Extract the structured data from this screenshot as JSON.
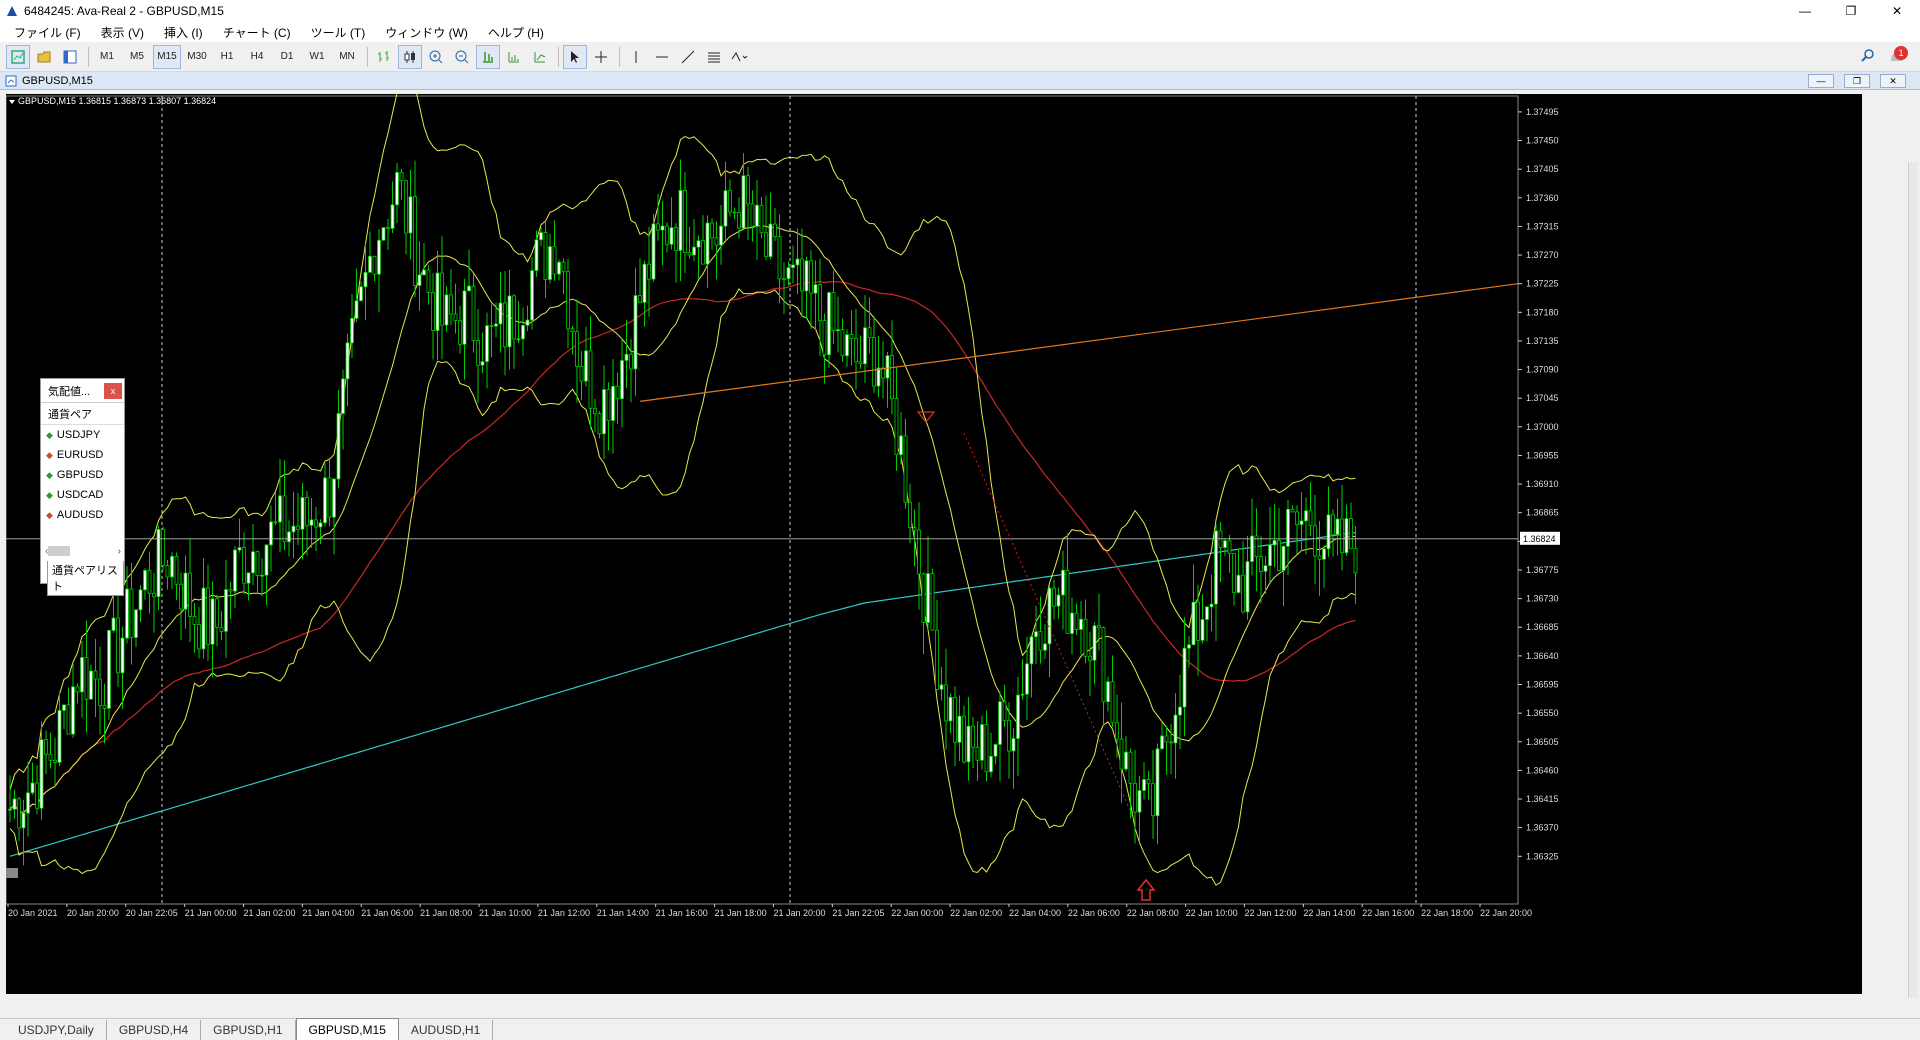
{
  "window": {
    "title": "6484245: Ava-Real 2 - GBPUSD,M15",
    "minimize": "—",
    "restore": "❐",
    "close": "✕"
  },
  "menu": [
    "ファイル (F)",
    "表示 (V)",
    "挿入 (I)",
    "チャート (C)",
    "ツール (T)",
    "ウィンドウ (W)",
    "ヘルプ (H)"
  ],
  "toolbar": {
    "timeframes": [
      "M1",
      "M5",
      "M15",
      "M30",
      "H1",
      "H4",
      "D1",
      "W1",
      "MN"
    ],
    "active_timeframe": "M15",
    "notification_count": "1"
  },
  "chart_window": {
    "title": "GBPUSD,M15",
    "info": "GBPUSD,M15  1.36815 1.36873 1.36807 1.36824"
  },
  "market_watch": {
    "title": "気配値...",
    "close": "x",
    "column": "通貨ペア",
    "symbols": [
      {
        "name": "USDJPY",
        "dir": "up"
      },
      {
        "name": "EURUSD",
        "dir": "down"
      },
      {
        "name": "GBPUSD",
        "dir": "up"
      },
      {
        "name": "USDCAD",
        "dir": "up"
      },
      {
        "name": "AUDUSD",
        "dir": "down"
      }
    ],
    "tab": "通貨ペアリスト"
  },
  "chart_tabs": [
    "USDJPY,Daily",
    "GBPUSD,H4",
    "GBPUSD,H1",
    "GBPUSD,M15",
    "AUDUSD,H1"
  ],
  "active_chart_tab": "GBPUSD,M15",
  "chart_data": {
    "type": "candlestick",
    "symbol": "GBPUSD",
    "timeframe": "M15",
    "ylim": [
      1.3625,
      1.3752
    ],
    "price_ticks": [
      "1.37495",
      "1.37450",
      "1.37405",
      "1.37360",
      "1.37315",
      "1.37270",
      "1.37225",
      "1.37180",
      "1.37135",
      "1.37090",
      "1.37045",
      "1.37000",
      "1.36955",
      "1.36910",
      "1.36865",
      "1.36820",
      "1.36775",
      "1.36730",
      "1.36685",
      "1.36640",
      "1.36595",
      "1.36550",
      "1.36505",
      "1.36460",
      "1.36415",
      "1.36370",
      "1.36325"
    ],
    "current_price": "1.36824",
    "time_labels": [
      "20 Jan 2021",
      "20 Jan 20:00",
      "20 Jan 22:05",
      "21 Jan 00:00",
      "21 Jan 02:00",
      "21 Jan 04:00",
      "21 Jan 06:00",
      "21 Jan 08:00",
      "21 Jan 10:00",
      "21 Jan 12:00",
      "21 Jan 14:00",
      "21 Jan 16:00",
      "21 Jan 18:00",
      "21 Jan 20:00",
      "21 Jan 22:05",
      "22 Jan 00:00",
      "22 Jan 02:00",
      "22 Jan 04:00",
      "22 Jan 06:00",
      "22 Jan 08:00",
      "22 Jan 10:00",
      "22 Jan 12:00",
      "22 Jan 14:00",
      "22 Jan 16:00",
      "22 Jan 18:00",
      "22 Jan 20:00"
    ],
    "close_path": [
      1.364,
      1.3644,
      1.365,
      1.3662,
      1.366,
      1.3668,
      1.3676,
      1.368,
      1.3671,
      1.3668,
      1.3679,
      1.3682,
      1.3684,
      1.3685,
      1.369,
      1.3712,
      1.373,
      1.3738,
      1.3725,
      1.3716,
      1.3718,
      1.3713,
      1.3717,
      1.3725,
      1.373,
      1.371,
      1.3704,
      1.3712,
      1.3725,
      1.3733,
      1.3732,
      1.373,
      1.3736,
      1.3728,
      1.3723,
      1.372,
      1.3715,
      1.371,
      1.3712,
      1.3698,
      1.3676,
      1.3658,
      1.3648,
      1.365,
      1.3655,
      1.367,
      1.3673,
      1.3671,
      1.3662,
      1.3645,
      1.3638,
      1.3657,
      1.3668,
      1.368,
      1.3675,
      1.368,
      1.3683,
      1.3686,
      1.368,
      1.3682
    ],
    "colors": {
      "background": "#000000",
      "bull": "#ffffff",
      "bear": "#000000",
      "wick": "#00cc00",
      "bollinger": "#e8e84a",
      "ma_long": "#c82828",
      "ma_200": "#30c8c8",
      "trendline": "#e07a1a",
      "grid": "#ffffff"
    }
  }
}
